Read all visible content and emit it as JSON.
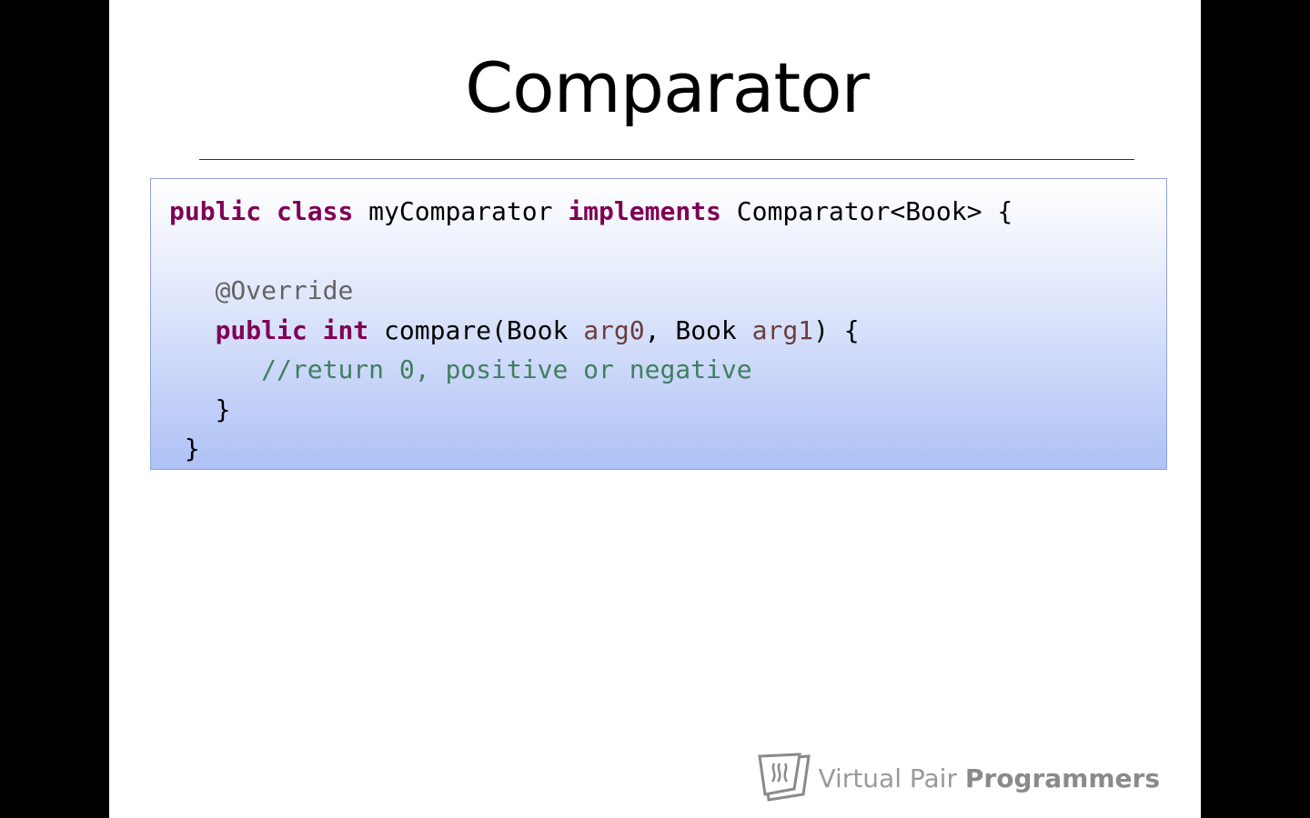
{
  "slide": {
    "title": "Comparator",
    "code": {
      "line1": {
        "kw_public": "public",
        "kw_class": "class",
        "class_name": "myComparator",
        "kw_implements": "implements",
        "interface": "Comparator<Book> {"
      },
      "line3": {
        "annotation": "@Override"
      },
      "line4": {
        "kw_public": "public",
        "kw_int": "int",
        "method": "compare(Book",
        "param0": "arg0",
        "sep": ", Book",
        "param1": "arg1",
        "end": ") {"
      },
      "line5": {
        "comment": "//return 0, positive or negative"
      },
      "line6": {
        "brace": "}"
      },
      "line7": {
        "brace": "}"
      }
    },
    "logo": {
      "light": "Virtual Pair",
      "bold": "Programmers"
    }
  },
  "colors": {
    "keyword": "#7f0055",
    "annotation": "#646464",
    "parameter": "#6a3e3e",
    "comment": "#3f7f5f"
  }
}
